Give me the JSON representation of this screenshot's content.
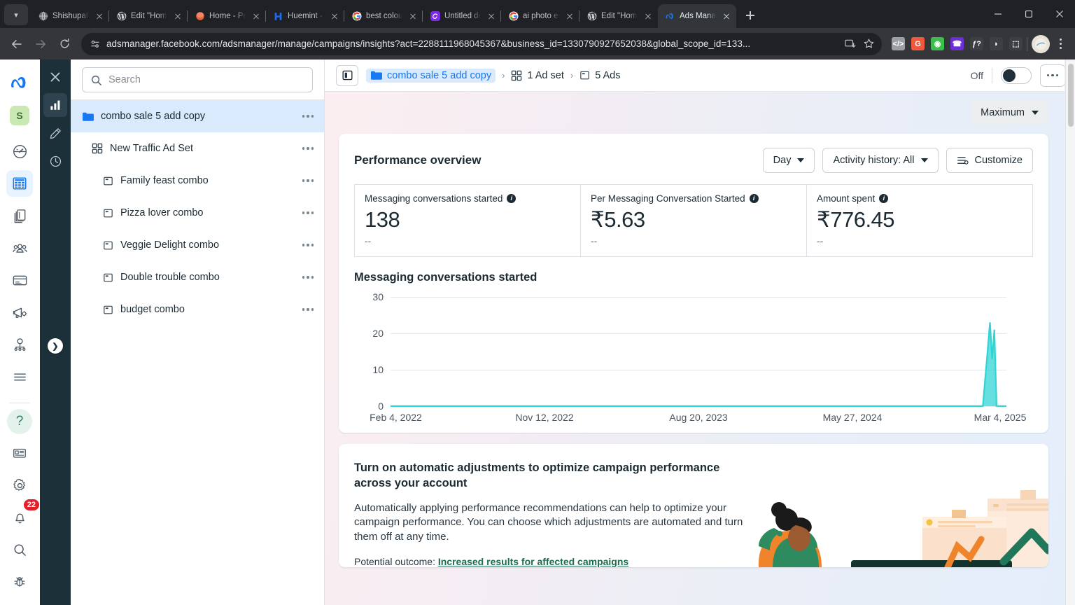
{
  "browser": {
    "tabs": [
      {
        "title": "Shishupal Ra",
        "icon": "globe-icon",
        "color": "#ffffff",
        "bg": "#5b5e62",
        "active": false
      },
      {
        "title": "Edit \"Home\"",
        "icon": "wordpress-icon",
        "color": "#ffffff",
        "bg": "#464a4e",
        "active": false
      },
      {
        "title": "Home - Pers",
        "icon": "circle-icon",
        "color": "#ffffff",
        "bg": "#e8613c",
        "active": false
      },
      {
        "title": "Huemint - Ge",
        "icon": "huemint-icon",
        "color": "#ffffff",
        "bg": "#1a6cf0",
        "active": false
      },
      {
        "title": "best colour fo",
        "icon": "google-icon",
        "color": "#ffffff",
        "bg": "#ffffff",
        "active": false
      },
      {
        "title": "Untitled desi",
        "icon": "canva-icon",
        "color": "#ffffff",
        "bg": "#7d2ae8",
        "active": false
      },
      {
        "title": "ai photo edit",
        "icon": "google-icon",
        "color": "#ffffff",
        "bg": "#ffffff",
        "active": false
      },
      {
        "title": "Edit \"Home\"",
        "icon": "wordpress-icon",
        "color": "#ffffff",
        "bg": "#464a4e",
        "active": false
      },
      {
        "title": "Ads Manager",
        "icon": "meta-icon",
        "color": "#1877f2",
        "bg": "#323639",
        "active": true
      }
    ],
    "new_tab_label": "New tab",
    "window_controls": {
      "minimize": "–",
      "maximize": "❐",
      "close": "✕"
    },
    "nav": {
      "back": "←",
      "forward": "→",
      "reload": "⟳"
    },
    "url": "adsmanager.facebook.com/adsmanager/manage/campaigns/insights?act=2288111968045367&business_id=1330790927652038&global_scope_id=133...",
    "extensions": [
      {
        "name": "code-extension-icon",
        "glyph": "</>",
        "bg": "#9aa0a6"
      },
      {
        "name": "grammarly-extension-icon",
        "glyph": "G",
        "bg": "#f0593b"
      },
      {
        "name": "colorpick-extension-icon",
        "glyph": "◉",
        "bg": "#3dbd4f"
      },
      {
        "name": "call-extension-icon",
        "glyph": "☎",
        "bg": "#6b2fd6"
      },
      {
        "name": "fonts-extension-icon",
        "glyph": "ƒ?",
        "bg": "#3c4043"
      },
      {
        "name": "tag-extension-icon",
        "glyph": "◗",
        "bg": "#3c4043"
      },
      {
        "name": "puzzle-extensions-icon",
        "glyph": "⬚",
        "bg": "#3c4043"
      }
    ],
    "profile_icon": "profile-avatar",
    "menu_icon": "browser-menu-icon",
    "bookmark_icon": "star-icon",
    "install_icon": "install-app-icon"
  },
  "rail": {
    "brand": "meta-logo",
    "account_initial": "S",
    "items": [
      {
        "name": "performance-gauge-icon",
        "glyph": "gauge"
      },
      {
        "name": "ads-manager-table-icon",
        "glyph": "table",
        "active": true
      },
      {
        "name": "library-icon",
        "glyph": "library"
      },
      {
        "name": "audiences-icon",
        "glyph": "people"
      },
      {
        "name": "billing-card-icon",
        "glyph": "card"
      },
      {
        "name": "ads-reporting-icon",
        "glyph": "megaphone"
      },
      {
        "name": "account-structure-icon",
        "glyph": "structure"
      },
      {
        "name": "all-tools-icon",
        "glyph": "menu"
      }
    ],
    "bottom_items": [
      {
        "name": "help-icon",
        "glyph": "?"
      },
      {
        "name": "news-icon",
        "glyph": "news"
      },
      {
        "name": "settings-gear-icon",
        "glyph": "gear"
      },
      {
        "name": "notifications-bell-icon",
        "glyph": "bell",
        "badge": "22"
      },
      {
        "name": "search-icon",
        "glyph": "search"
      },
      {
        "name": "bug-report-icon",
        "glyph": "bug"
      }
    ]
  },
  "dark_rail": {
    "items": [
      {
        "name": "close-panel-icon",
        "glyph": "✕"
      },
      {
        "name": "charts-icon",
        "glyph": "chart",
        "selected": true
      },
      {
        "name": "edit-pencil-icon",
        "glyph": "pencil"
      },
      {
        "name": "history-clock-icon",
        "glyph": "clock"
      }
    ],
    "expand_icon": "expand-chevron-icon"
  },
  "tree": {
    "search_placeholder": "Search",
    "search_value": "",
    "rows": [
      {
        "label": "combo sale 5 add copy",
        "level": "campaign",
        "icon": "folder-icon",
        "selected": true
      },
      {
        "label": "New Traffic Ad Set",
        "level": "adset",
        "icon": "adset-grid-icon",
        "selected": false
      },
      {
        "label": "Family feast combo",
        "level": "ad",
        "icon": "ad-icon",
        "selected": false
      },
      {
        "label": "Pizza lover combo",
        "level": "ad",
        "icon": "ad-icon",
        "selected": false
      },
      {
        "label": "Veggie Delight combo",
        "level": "ad",
        "icon": "ad-icon",
        "selected": false
      },
      {
        "label": "Double trouble combo",
        "level": "ad",
        "icon": "ad-icon",
        "selected": false
      },
      {
        "label": "budget combo",
        "level": "ad",
        "icon": "ad-icon",
        "selected": false
      }
    ],
    "row_menu_icon": "row-more-options-icon"
  },
  "header": {
    "panel_toggle_icon": "toggle-side-panel-icon",
    "breadcrumb": [
      {
        "label": "combo sale 5 add copy",
        "icon": "folder-icon",
        "link": true
      },
      {
        "label": "1 Ad set",
        "icon": "adset-grid-icon",
        "link": false
      },
      {
        "label": "5 Ads",
        "icon": "ad-icon",
        "link": false
      }
    ],
    "separator": "›",
    "status_label": "Off",
    "status_on": false,
    "more_icon": "more-options-icon"
  },
  "subbar": {
    "range_label": "Maximum"
  },
  "overview": {
    "title": "Performance overview",
    "buttons": [
      {
        "label": "Day",
        "name": "day-dropdown",
        "caret": true
      },
      {
        "label": "Activity history: All",
        "name": "activity-history-dropdown",
        "caret": true
      },
      {
        "label": "Customize",
        "name": "customize-button",
        "caret": false,
        "icon": "customize-icon"
      }
    ],
    "metrics": [
      {
        "label": "Messaging conversations started",
        "value": "138",
        "sub": "--"
      },
      {
        "label": "Per Messaging Conversation Started",
        "value": "₹5.63",
        "sub": "--"
      },
      {
        "label": "Amount spent",
        "value": "₹776.45",
        "sub": "--"
      }
    ]
  },
  "chart_data": {
    "type": "area",
    "title": "Messaging conversations started",
    "xlabel": "",
    "ylabel": "",
    "ylim": [
      0,
      30
    ],
    "yticks": [
      0,
      10,
      20,
      30
    ],
    "xticks": [
      "Feb 4, 2022",
      "Nov 12, 2022",
      "Aug 20, 2023",
      "May 27, 2024",
      "Mar 4, 2025"
    ],
    "grid": true,
    "legend": "none",
    "series": [
      {
        "name": "Messaging conversations started",
        "color": "#31d4d4",
        "x": [
          "Feb 4, 2022",
          "Jan 20, 2025",
          "Jan 28, 2025",
          "Feb 2, 2025",
          "Feb 6, 2025",
          "Feb 10, 2025",
          "Feb 14, 2025",
          "Mar 4, 2025"
        ],
        "values": [
          0,
          0,
          14,
          23,
          13,
          21,
          0,
          0
        ]
      }
    ]
  },
  "promo": {
    "heading": "Turn on automatic adjustments to optimize campaign performance across your account",
    "body": "Automatically applying performance recommendations can help to optimize your campaign performance. You can choose which adjustments are automated and turn them off at any time.",
    "outcome_prefix": "Potential outcome: ",
    "outcome_link": "Increased results for affected campaigns",
    "art": "person-with-growth-chart-illustration"
  },
  "colors": {
    "accent_blue": "#1877f2",
    "chart_teal": "#31d4d4",
    "dark_rail": "#1c3039",
    "selected_row": "#d8eafc",
    "badge_red": "#e41e2b",
    "link_green": "#1d6e4e"
  }
}
